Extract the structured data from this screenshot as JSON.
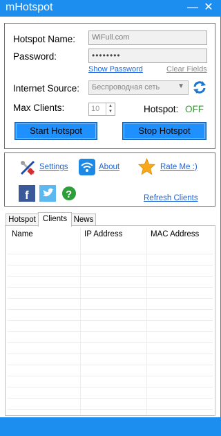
{
  "window": {
    "title": "mHotspot",
    "minimize": "—",
    "close": "✕"
  },
  "form": {
    "hotspot_name_label": "Hotspot Name:",
    "hotspot_name_value": "WiFull.com",
    "password_label": "Password:",
    "password_value": "••••••••",
    "show_password": "Show Password",
    "clear_fields": "Clear Fields",
    "internet_source_label": "Internet Source:",
    "internet_source_value": "Беспроводная сеть",
    "max_clients_label": "Max Clients:",
    "max_clients_value": "10",
    "hotspot_status_label": "Hotspot:",
    "hotspot_status_value": "OFF",
    "hotspot_status_color": "#2a9d2a",
    "start_button": "Start Hotspot",
    "stop_button": "Stop Hotspot"
  },
  "links": {
    "settings": "Settings",
    "about": "About",
    "rate_me": "Rate Me :)",
    "refresh_clients": "Refresh Clients",
    "icons": [
      "tools-icon",
      "wifi-icon",
      "star-icon",
      "facebook-icon",
      "twitter-icon",
      "help-icon"
    ]
  },
  "tabs": [
    {
      "label": "Hotspot",
      "active": false
    },
    {
      "label": "Clients",
      "active": true
    },
    {
      "label": "News",
      "active": false
    }
  ],
  "clients_table": {
    "columns": [
      "Name",
      "IP Address",
      "MAC Address"
    ],
    "rows": []
  },
  "colors": {
    "accent": "#1c8ef0",
    "button": "#1e90ff",
    "link": "#1e64d8"
  }
}
